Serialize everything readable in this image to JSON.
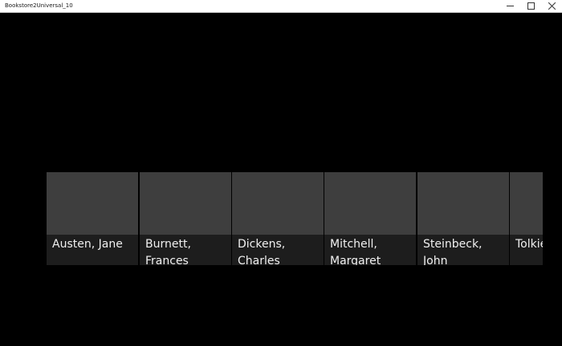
{
  "window": {
    "title": "Bookstore2Universal_10",
    "icons": {
      "minimize": "minimize-icon",
      "maximize": "maximize-icon",
      "close": "close-icon"
    }
  },
  "authors": [
    {
      "name": "Austen, Jane"
    },
    {
      "name": "Burnett, Frances"
    },
    {
      "name": "Dickens, Charles"
    },
    {
      "name": "Mitchell, Margaret"
    },
    {
      "name": "Steinbeck, John"
    },
    {
      "name": "Tolkien"
    }
  ],
  "colors": {
    "background": "#000000",
    "tile_image": "#3e3e3e",
    "tile_caption": "#1d1d1d",
    "text": "#f0f0f0"
  }
}
